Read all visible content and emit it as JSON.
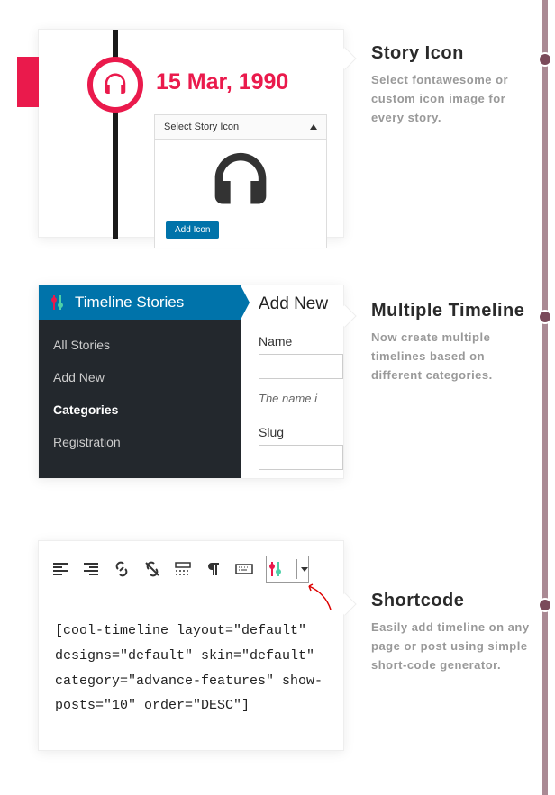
{
  "section1": {
    "title": "Story Icon",
    "desc": "Select fontawesome or custom icon image for every story.",
    "date": "15 Mar, 1990",
    "panel_header": "Select Story Icon",
    "button": "Add Icon"
  },
  "section2": {
    "title": "Multiple Timeline",
    "desc": "Now create multiple timelines based on different categories.",
    "sidebar_title": "Timeline Stories",
    "menu": [
      "All Stories",
      "Add New",
      "Categories",
      "Registration"
    ],
    "active_index": 2,
    "right_heading": "Add New",
    "label_name": "Name",
    "hint": "The name i",
    "label_slug": "Slug"
  },
  "section3": {
    "title": "Shortcode",
    "desc": "Easily add timeline on any page or post using simple short-code generator.",
    "code": "[cool-timeline layout=\"default\" designs=\"default\" skin=\"default\" category=\"advance-features\" show-posts=\"10\" order=\"DESC\"]"
  }
}
